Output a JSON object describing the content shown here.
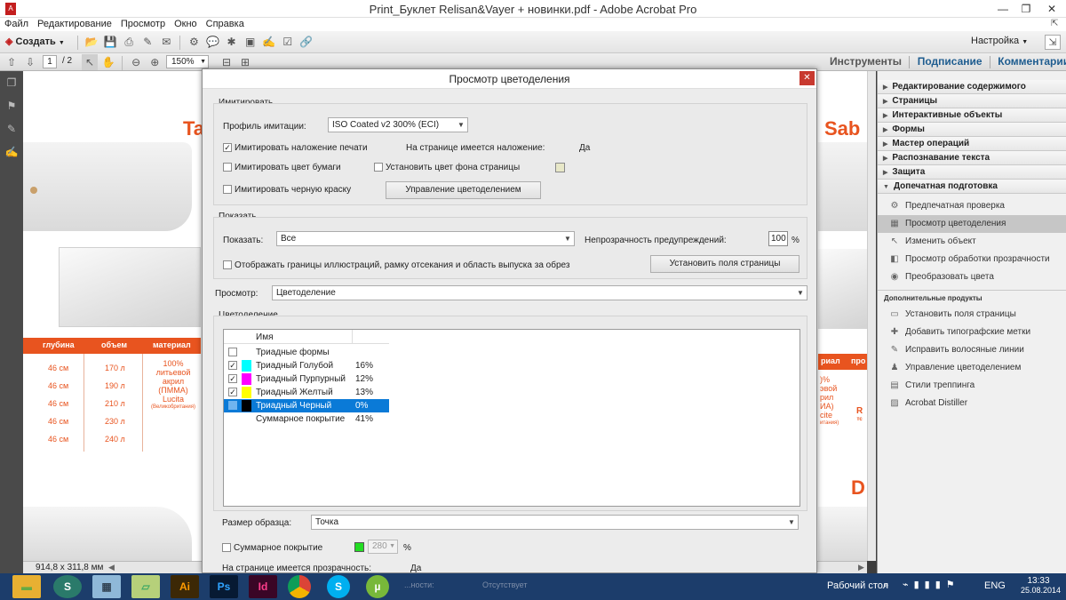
{
  "window": {
    "title": "Print_Буклет Relisan&Vayer + новинки.pdf - Adobe Acrobat Pro"
  },
  "menu": [
    "Файл",
    "Редактирование",
    "Просмотр",
    "Окно",
    "Справка"
  ],
  "toolbar": {
    "create_label": "Создать",
    "settings_label": "Настройка"
  },
  "nav": {
    "page_current": "1",
    "page_total": "/ 2",
    "zoom": "150%"
  },
  "tabs": {
    "tools": "Инструменты",
    "sign": "Подписание",
    "comments": "Комментарии"
  },
  "right_panel": {
    "sections": [
      "Редактирование содержимого",
      "Страницы",
      "Интерактивные объекты",
      "Формы",
      "Мастер операций",
      "Распознавание текста",
      "Защита"
    ],
    "open_section": "Допечатная подготовка",
    "items": [
      {
        "label": "Предпечатная проверка",
        "icon": "preflight-icon",
        "glyph": "⚙"
      },
      {
        "label": "Просмотр цветоделения",
        "icon": "separation-icon",
        "glyph": "▦"
      },
      {
        "label": "Изменить объект",
        "icon": "edit-object-icon",
        "glyph": "↖"
      },
      {
        "label": "Просмотр обработки прозрачности",
        "icon": "flattener-icon",
        "glyph": "◧"
      },
      {
        "label": "Преобразовать цвета",
        "icon": "convert-colors-icon",
        "glyph": "◉"
      }
    ],
    "extra_header": "Дополнительные продукты",
    "extra_items": [
      {
        "label": "Установить поля страницы",
        "icon": "page-boxes-icon",
        "glyph": "▭"
      },
      {
        "label": "Добавить типографские метки",
        "icon": "printer-marks-icon",
        "glyph": "✚"
      },
      {
        "label": "Исправить волосяные линии",
        "icon": "hairlines-icon",
        "glyph": "✎"
      },
      {
        "label": "Управление цветоделением",
        "icon": "ink-manager-icon",
        "glyph": "♟"
      },
      {
        "label": "Стили треппинга",
        "icon": "trap-icon",
        "glyph": "▤"
      },
      {
        "label": "Acrobat Distiller",
        "icon": "distiller-icon",
        "glyph": "▨"
      }
    ]
  },
  "doc": {
    "table_headers": [
      "глубина",
      "объем",
      "материал"
    ],
    "depth": [
      "46 см",
      "46 см",
      "46 см",
      "46 см",
      "46 см"
    ],
    "volume": [
      "170 л",
      "190 л",
      "210 л",
      "230 л",
      "240 л"
    ],
    "material": [
      "100%",
      "литьевой",
      "акрил",
      "(ПММА)",
      "Lucita"
    ],
    "material_small": "(Великобритания)",
    "left_heading": "Ta",
    "right_heading": "Sab",
    "right_header_partial": [
      "риал",
      "про"
    ],
    "right_material_partial": [
      ")%",
      "эвой",
      "рил",
      "ИА)",
      "cite",
      "итания)"
    ],
    "right_mark": "D",
    "right_red_partial": "R",
    "right_red_small": "тс"
  },
  "status": {
    "dimensions": "914,8 x 311,8 мм"
  },
  "dialog": {
    "title": "Просмотр цветоделения",
    "simulate": {
      "group_title": "Имитировать",
      "profile_label": "Профиль имитации:",
      "profile_value": "ISO Coated v2 300% (ECI)",
      "overprint_label": "Имитировать наложение печати",
      "overprint_checked": true,
      "overprint_info_label": "На странице имеется наложение:",
      "overprint_info_value": "Да",
      "paper_label": "Имитировать цвет бумаги",
      "bg_label": "Установить цвет фона страницы",
      "black_label": "Имитировать черную краску",
      "ink_manager_button": "Управление цветоделением"
    },
    "show": {
      "group_title": "Показать",
      "show_label": "Показать:",
      "show_value": "Все",
      "opacity_label": "Непрозрачность предупреждений:",
      "opacity_value": "100",
      "opacity_unit": "%",
      "boxes_label": "Отображать границы иллюстраций, рамку отсекания и область выпуска за обрез",
      "page_boxes_button": "Установить поля страницы"
    },
    "preview": {
      "label": "Просмотр:",
      "value": "Цветоделение"
    },
    "separations": {
      "group_title": "Цветоделение",
      "col_name": "Имя",
      "rows": [
        {
          "name": "Триадные формы",
          "value": "",
          "checked": false,
          "swatch": ""
        },
        {
          "name": "Триадный Голубой",
          "value": "16%",
          "checked": true,
          "swatch": "#00ffff"
        },
        {
          "name": "Триадный Пурпурный",
          "value": "12%",
          "checked": true,
          "swatch": "#ff00ff"
        },
        {
          "name": "Триадный Желтый",
          "value": "13%",
          "checked": true,
          "swatch": "#ffff00"
        },
        {
          "name": "Триадный Черный",
          "value": "0%",
          "checked": false,
          "swatch": "#000000"
        },
        {
          "name": "Суммарное покрытие",
          "value": "41%",
          "checked": false,
          "swatch": ""
        }
      ]
    },
    "sample": {
      "label": "Размер образца:",
      "value": "Точка"
    },
    "total": {
      "label": "Суммарное покрытие",
      "value": "280",
      "unit": "%"
    },
    "transparency": {
      "label": "На странице имеется прозрачность:",
      "value": "Да"
    },
    "partial": {
      "label": "...ности:",
      "value": "Отсутствует"
    }
  },
  "taskbar": {
    "desktop": "Рабочий стол",
    "lang": "ENG",
    "time": "13:33",
    "date": "25.08.2014"
  },
  "colors": {
    "accent": "#e8541f",
    "selection": "#0a7ad7",
    "taskbar": "#1c3d6b"
  }
}
